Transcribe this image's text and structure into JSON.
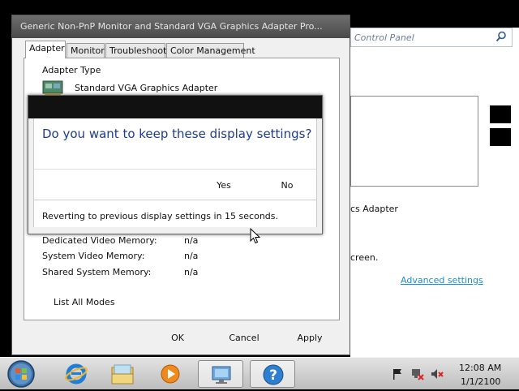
{
  "background_window": {
    "search_placeholder": "Control Panel",
    "adapter_text": "cs Adapter",
    "screen_text": "creen.",
    "advanced_settings_link": "Advanced settings"
  },
  "properties_dialog": {
    "title": "Generic Non-PnP Monitor and Standard VGA Graphics Adapter Pro...",
    "tabs": [
      "Adapter",
      "Monitor",
      "Troubleshoot",
      "Color Management"
    ],
    "adapter_type_label": "Adapter Type",
    "adapter_name": "Standard VGA Graphics Adapter",
    "memory": [
      {
        "label": "Dedicated Video Memory:",
        "value": "n/a"
      },
      {
        "label": "System Video Memory:",
        "value": "n/a"
      },
      {
        "label": "Shared System Memory:",
        "value": "n/a"
      }
    ],
    "list_all_modes_label": "List All Modes",
    "ok_label": "OK",
    "cancel_label": "Cancel",
    "apply_label": "Apply"
  },
  "confirm_dialog": {
    "question": "Do you want to keep these display settings?",
    "yes_label": "Yes",
    "no_label": "No",
    "countdown_text": "Reverting to previous display settings in 15 seconds."
  },
  "taskbar": {
    "start_icon": "windows-orb-icon",
    "pinned": [
      "internet-explorer-icon",
      "windows-explorer-icon",
      "media-player-icon",
      "display-settings-icon",
      "help-icon"
    ],
    "active_item": "display-settings-icon",
    "clock_time": "12:08 AM",
    "clock_date": "1/1/2100"
  },
  "colors": {
    "question_blue": "#1e3c8c",
    "link_blue": "#1a8fd0",
    "title_bar": "#4a4a4a"
  }
}
